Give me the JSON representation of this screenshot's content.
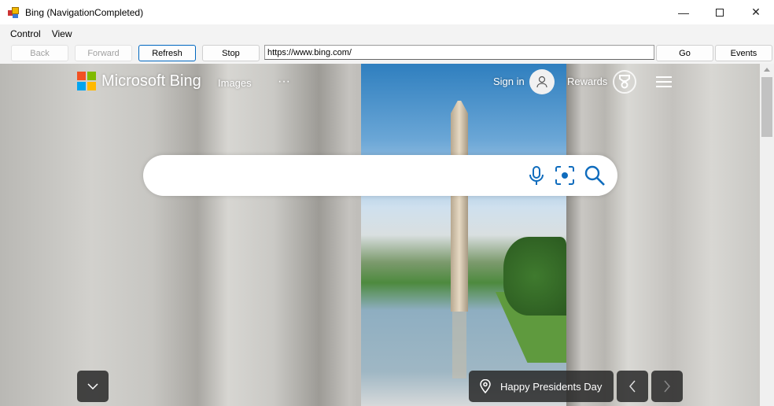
{
  "window": {
    "title": "Bing (NavigationCompleted)",
    "controls": [
      "minimize",
      "maximize",
      "close"
    ]
  },
  "menubar": {
    "items": [
      "Control",
      "View"
    ]
  },
  "toolbar": {
    "back": "Back",
    "forward": "Forward",
    "refresh": "Refresh",
    "stop": "Stop",
    "address": "https://www.bing.com/",
    "go": "Go",
    "events": "Events"
  },
  "bing": {
    "logo_text": "Microsoft Bing",
    "nav_images": "Images",
    "more": "···",
    "sign_in": "Sign in",
    "rewards": "Rewards",
    "search_placeholder": "",
    "caption": "Happy Presidents Day",
    "icons": [
      "microphone-icon",
      "visual-search-icon",
      "search-icon",
      "chevron-down-icon",
      "location-pin-icon",
      "chevron-left-icon",
      "chevron-right-icon"
    ],
    "accent": "#0f6cbd"
  }
}
